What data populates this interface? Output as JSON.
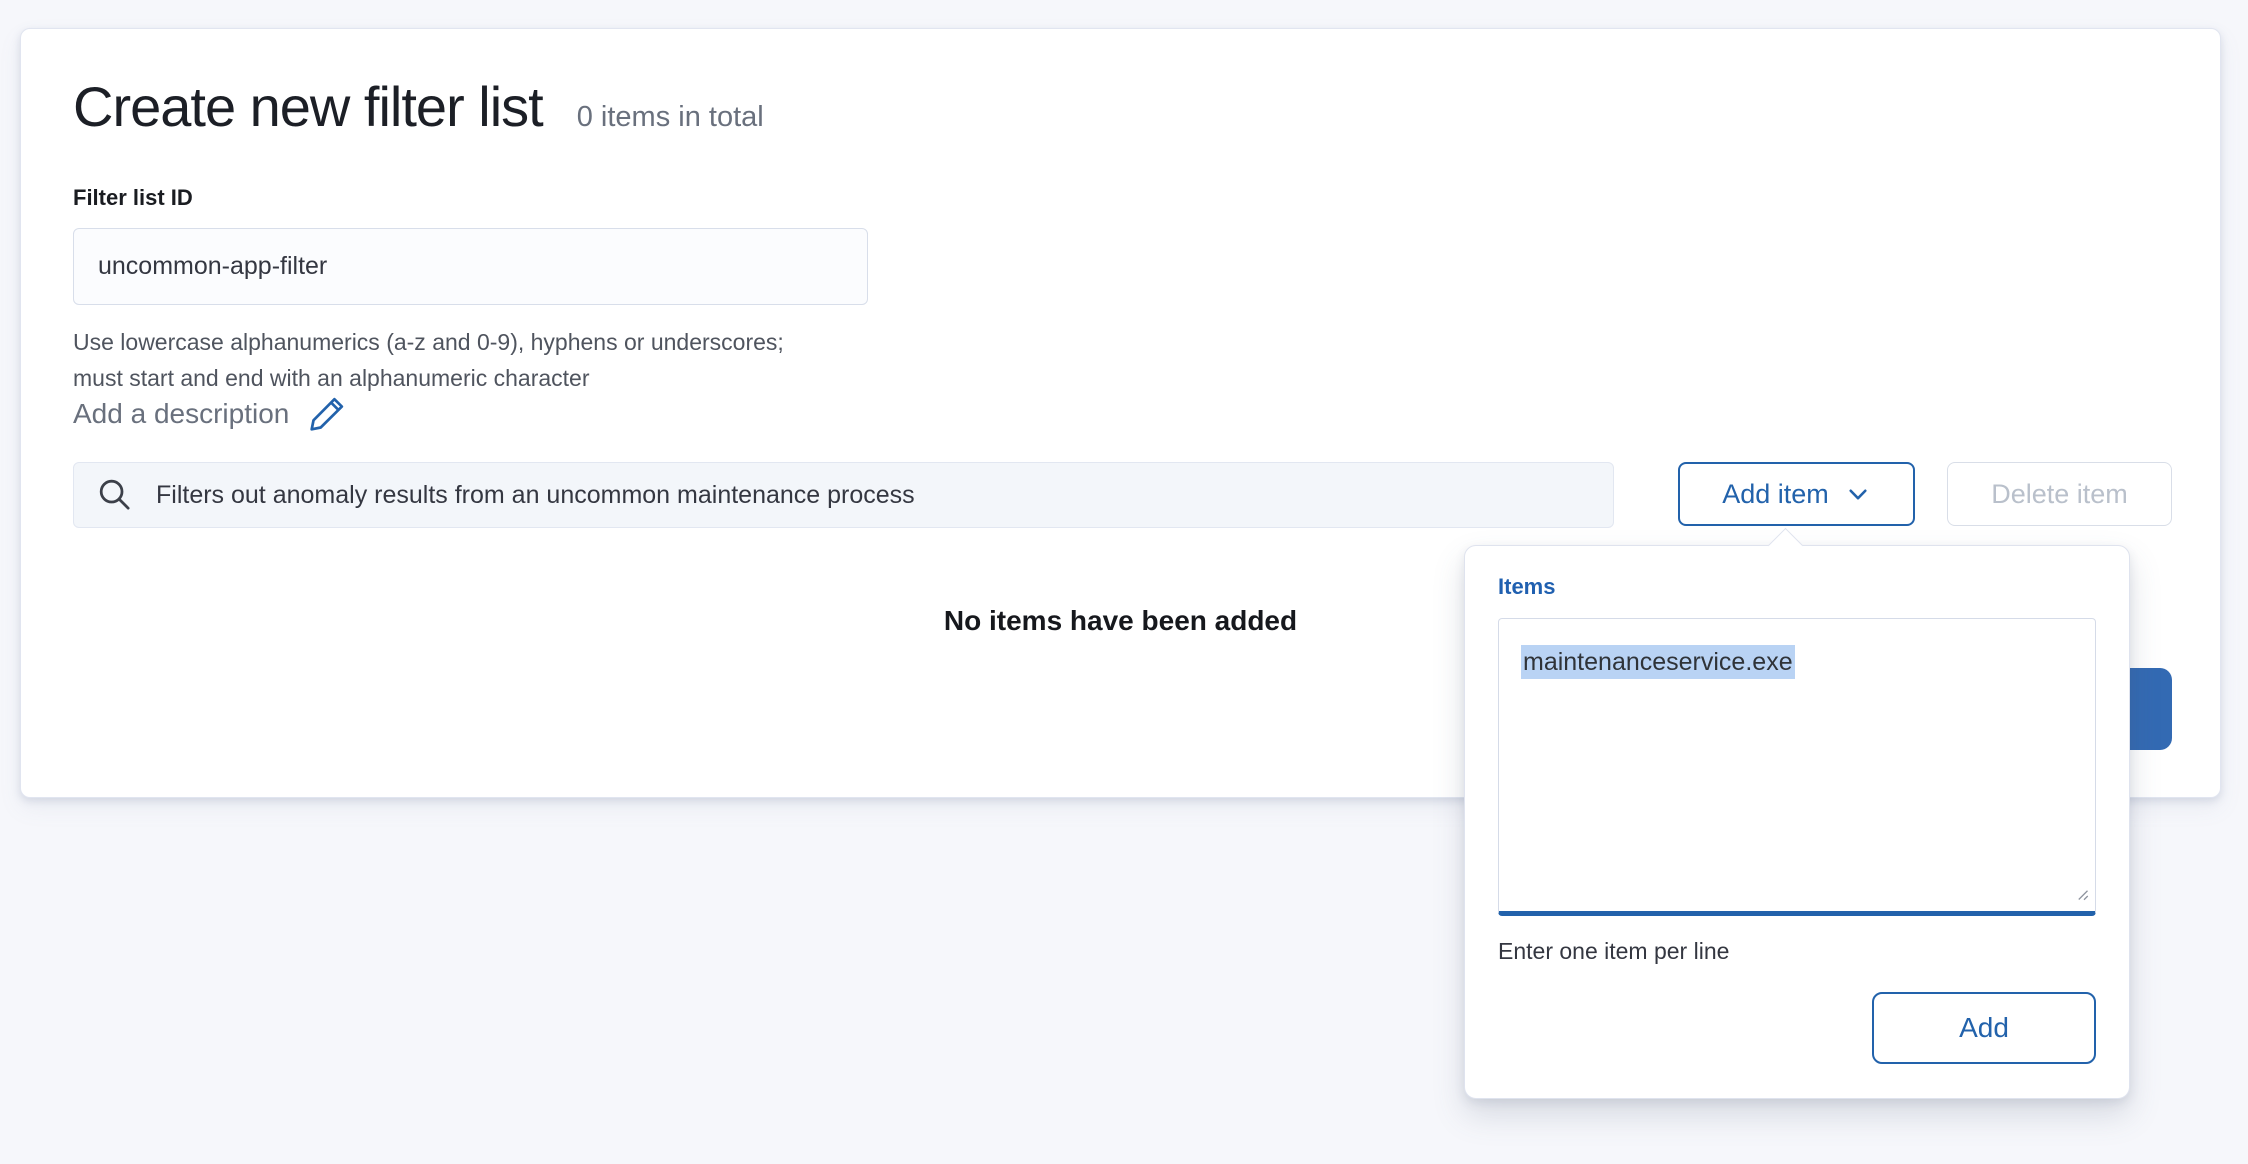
{
  "header": {
    "title": "Create new filter list",
    "items_total": "0 items in total"
  },
  "id_field": {
    "label": "Filter list ID",
    "value": "uncommon-app-filter",
    "help_line1": "Use lowercase alphanumerics (a-z and 0-9), hyphens or underscores;",
    "help_line2": "must start and end with an alphanumeric character"
  },
  "description": {
    "label": "Add a description",
    "icon": "pencil-icon"
  },
  "search": {
    "value": "Filters out anomaly results from an uncommon maintenance process",
    "icon": "search-icon"
  },
  "toolbar": {
    "add_item_label": "Add item",
    "delete_item_label": "Delete item"
  },
  "empty_message": "No items have been added",
  "popover": {
    "label": "Items",
    "items_value": "maintenanceservice.exe",
    "help": "Enter one item per line",
    "add_label": "Add"
  },
  "colors": {
    "accent_blue": "#2262ab",
    "primary_fill_blue": "#336ab3",
    "subdued_text": "#69707d",
    "disabled_text": "#b9c0cb",
    "selection_highlight": "#b9d3f4",
    "dark_text": "#343741",
    "page_background": "#f6f7fb"
  }
}
